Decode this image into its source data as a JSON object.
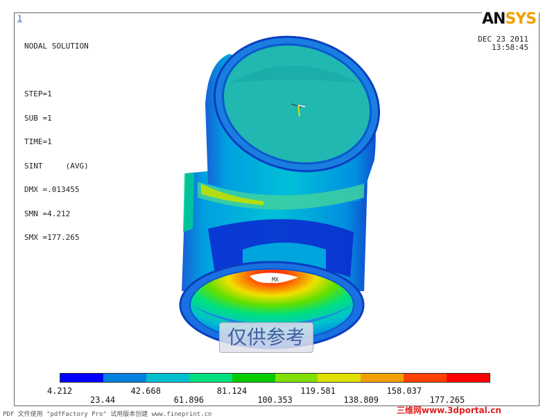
{
  "window_number": "1",
  "info_lines": [
    "NODAL SOLUTION",
    "",
    "STEP=1",
    "SUB =1",
    "TIME=1",
    "SINT     (AVG)",
    "DMX =.013455",
    "SMN =4.212",
    "SMX =177.265"
  ],
  "date": "DEC 23 2011",
  "time": "13:58:45",
  "logo": {
    "part1": "AN",
    "part2": "SYS"
  },
  "mx_label": "MX",
  "watermark": "仅供参考",
  "legend": {
    "colors": [
      "#0000ff",
      "#0080e0",
      "#00c0d0",
      "#00e080",
      "#00cc00",
      "#80e000",
      "#e0e000",
      "#f0a000",
      "#ff4000",
      "#ff0000"
    ],
    "top_labels": [
      "4.212",
      "42.668",
      "81.124",
      "119.581",
      "158.037"
    ],
    "bottom_labels": [
      "23.44",
      "61.896",
      "100.353",
      "138.809",
      "177.265"
    ]
  },
  "footer_left": "PDF 文件使用 \"pdfFactory Pro\" 试用版本创建 www.fineprint.cn",
  "footer_right": "三维网www.3dportal.cn"
}
